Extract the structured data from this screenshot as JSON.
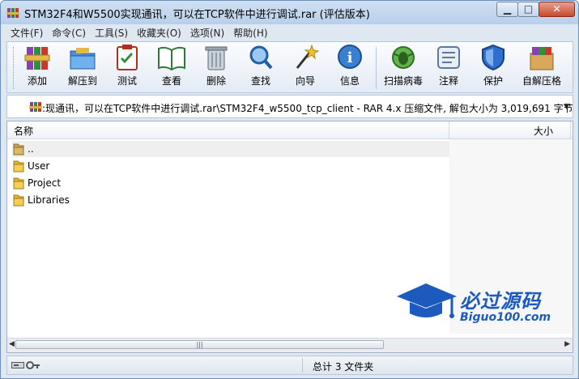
{
  "window": {
    "title": "STM32F4和W5500实现通讯，可以在TCP软件中进行调试.rar (评估版本)"
  },
  "menu": [
    "文件(F)",
    "命令(C)",
    "工具(S)",
    "收藏夹(O)",
    "选项(N)",
    "帮助(H)"
  ],
  "toolbar": [
    {
      "label": "添加",
      "icon": "books-add-icon"
    },
    {
      "label": "解压到",
      "icon": "folder-extract-icon"
    },
    {
      "label": "测试",
      "icon": "clipboard-check-icon"
    },
    {
      "label": "查看",
      "icon": "open-book-icon"
    },
    {
      "label": "删除",
      "icon": "trash-can-icon"
    },
    {
      "label": "查找",
      "icon": "magnifier-icon"
    },
    {
      "label": "向导",
      "icon": "magic-wand-icon"
    },
    {
      "label": "信息",
      "icon": "info-icon"
    },
    {
      "label": "扫描病毒",
      "icon": "virus-scan-icon"
    },
    {
      "label": "注释",
      "icon": "comment-icon"
    },
    {
      "label": "保护",
      "icon": "shield-icon"
    },
    {
      "label": "自解压格",
      "icon": "sfx-box-icon"
    }
  ],
  "address": {
    "path": ":现通讯，可以在TCP软件中进行调试.rar\\STM32F4_w5500_tcp_client - RAR 4.x 压缩文件, 解包大小为 3,019,691 字节"
  },
  "columns": {
    "name": "名称",
    "size": "大小"
  },
  "files": [
    {
      "name": "..",
      "type": "parent"
    },
    {
      "name": "User",
      "type": "folder"
    },
    {
      "name": "Project",
      "type": "folder"
    },
    {
      "name": "Libraries",
      "type": "folder"
    }
  ],
  "watermark": {
    "title": "必过源码",
    "subtitle": "Biguo100.com"
  },
  "status": {
    "text": "总计 3 文件夹"
  },
  "colors": {
    "titlebar": "#b9cfe9",
    "close": "#c84a30",
    "accent": "#1c5bbd"
  }
}
